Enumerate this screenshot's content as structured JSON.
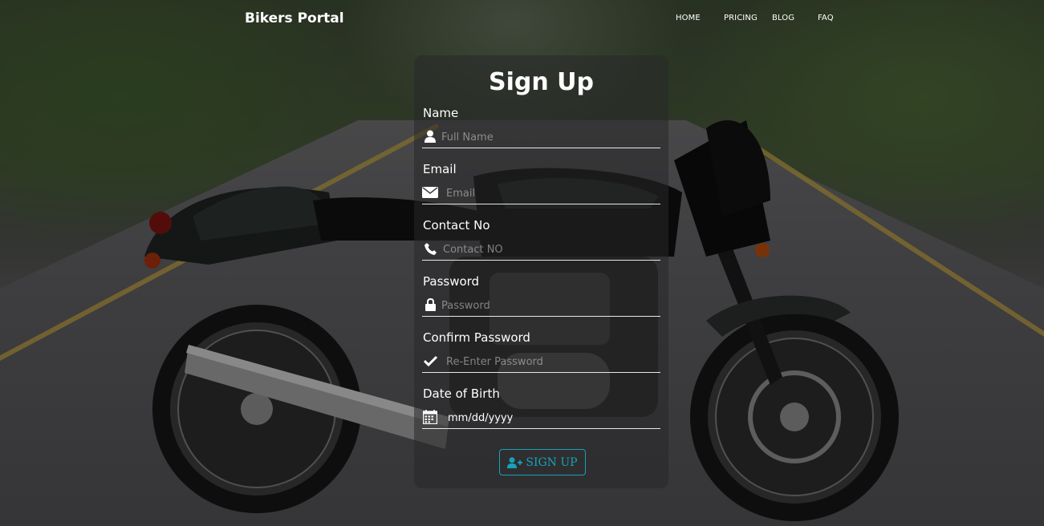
{
  "navbar": {
    "brand": "Bikers Portal",
    "links": [
      "HOME",
      "PRICING",
      "BLOG",
      "FAQ"
    ]
  },
  "form": {
    "title": "Sign Up",
    "fields": [
      {
        "label": "Name",
        "placeholder": "Full Name",
        "icon": "user-icon"
      },
      {
        "label": "Email",
        "placeholder": "Email",
        "icon": "envelope-icon"
      },
      {
        "label": "Contact No",
        "placeholder": "Contact NO",
        "icon": "phone-icon"
      },
      {
        "label": "Password",
        "placeholder": "Password",
        "icon": "lock-icon"
      },
      {
        "label": "Confirm Password",
        "placeholder": "Re-Enter Password",
        "icon": "check-icon"
      },
      {
        "label": "Date of Birth",
        "value": "mm/dd/yyyy",
        "icon": "calendar-icon"
      }
    ],
    "submit_label": "SIGN UP",
    "submit_icon": "user-plus-icon"
  },
  "colors": {
    "accent": "#17a2b8",
    "text": "#ffffff",
    "card_bg": "rgba(40,40,42,0.55)"
  }
}
